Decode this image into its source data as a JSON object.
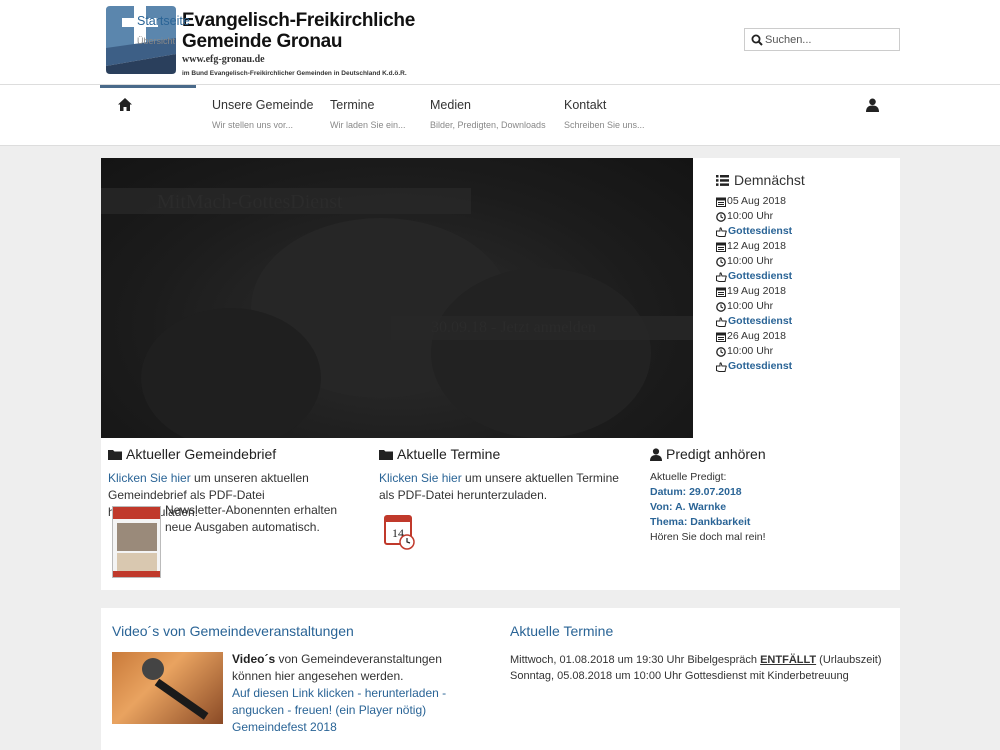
{
  "header": {
    "logo_title_line1": "Evangelisch-Freikirchliche",
    "logo_title_line2": "Gemeinde Gronau",
    "logo_url": "www.efg-gronau.de",
    "logo_tagline": "im Bund Evangelisch-Freikirchlicher Gemeinden in Deutschland K.d.ö.R.",
    "search_placeholder": "Suchen..."
  },
  "nav": {
    "items": [
      {
        "label": "Startseite",
        "sub": "Übersicht",
        "active": true
      },
      {
        "label": "Unsere Gemeinde",
        "sub": "Wir stellen uns vor..."
      },
      {
        "label": "Termine",
        "sub": "Wir laden Sie ein..."
      },
      {
        "label": "Medien",
        "sub": "Bilder, Predigten, Downloads"
      },
      {
        "label": "Kontakt",
        "sub": "Schreiben Sie uns..."
      }
    ]
  },
  "slider": {
    "title": "MitMach-GottesDienst",
    "date_text": "30.09.18  -  Jetzt anmelden"
  },
  "upcoming": {
    "heading": "Demnächst",
    "events": [
      {
        "date": "05 Aug 2018",
        "time": "10:00 Uhr",
        "title": "Gottesdienst"
      },
      {
        "date": "12 Aug 2018",
        "time": "10:00 Uhr",
        "title": "Gottesdienst"
      },
      {
        "date": "19 Aug 2018",
        "time": "10:00 Uhr",
        "title": "Gottesdienst"
      },
      {
        "date": "26 Aug 2018",
        "time": "10:00 Uhr",
        "title": "Gottesdienst"
      }
    ]
  },
  "gemeindebrief": {
    "heading": "Aktueller Gemeindebrief",
    "link": "Klicken Sie hier",
    "text": " um unseren aktuellen Gemeindebrief als PDF-Datei herunterzuladen.",
    "extra": "Newsletter-Abonennten erhalten neue Ausgaben automatisch."
  },
  "termine_box": {
    "heading": "Aktuelle Termine",
    "link": "Klicken Sie hier",
    "text": " um unsere aktuellen Termine als PDF-Datei herunterzuladen.",
    "calendar_day": "14"
  },
  "predigt": {
    "heading": "Predigt anhören",
    "intro": "Aktuelle Predigt:",
    "datum": "Datum: 29.07.2018",
    "von": "Von: A. Warnke",
    "thema": "Thema: Dankbarkeit",
    "outro": "Hören Sie doch mal rein!"
  },
  "videos": {
    "heading": "Video´s von Gemeindeveranstaltungen",
    "bold": "Video´s",
    "text": " von Gemeindeveranstaltungen können hier angesehen werden.",
    "link": "Auf diesen Link klicken - herunterladen - angucken - freuen! (ein Player nötig)",
    "link2": "Gemeindefest 2018"
  },
  "aktuelle_termine": {
    "heading": "Aktuelle Termine",
    "line1_pre": "Mittwoch, 01.08.2018 um 19:30 Uhr Bibelgespräch ",
    "line1_strong": "ENTFÄLLT",
    "line1_post": " (Urlaubszeit)",
    "line2": "Sonntag, 05.08.2018 um 10:00 Uhr Gottesdienst mit Kinderbetreuung"
  },
  "colors": {
    "link": "#2a6496",
    "logo_blue": "#3d5f86",
    "logo_dark": "#2a3f5c"
  }
}
